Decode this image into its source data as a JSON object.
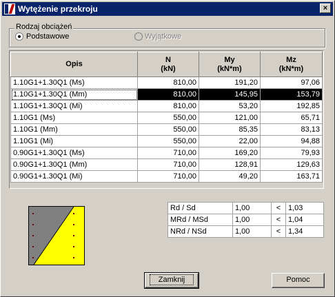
{
  "window": {
    "title": "Wytężenie przekroju",
    "close_glyph": "×"
  },
  "load_group": {
    "title": "Rodzaj obciążeń",
    "options": [
      {
        "label": "Podstawowe",
        "selected": true,
        "enabled": true
      },
      {
        "label": "Wyjątkowe",
        "selected": false,
        "enabled": false
      }
    ]
  },
  "table": {
    "columns": [
      {
        "line1": "Opis",
        "line2": ""
      },
      {
        "line1": "N",
        "line2": "(kN)"
      },
      {
        "line1": "My",
        "line2": "(kN*m)"
      },
      {
        "line1": "Mz",
        "line2": "(kN*m)"
      }
    ],
    "rows": [
      [
        "1.10G1+1.30Q1 (Ms)",
        "810,00",
        "191,20",
        "97,06"
      ],
      [
        "1.10G1+1.30Q1 (Mm)",
        "810,00",
        "145,95",
        "153,79"
      ],
      [
        "1.10G1+1.30Q1 (Mi)",
        "810,00",
        "53,20",
        "192,85"
      ],
      [
        "1.10G1 (Ms)",
        "550,00",
        "121,00",
        "65,71"
      ],
      [
        "1.10G1 (Mm)",
        "550,00",
        "85,35",
        "83,13"
      ],
      [
        "1.10G1 (Mi)",
        "550,00",
        "22,00",
        "94,88"
      ],
      [
        "0.90G1+1.30Q1 (Ms)",
        "710,00",
        "169,20",
        "79,93"
      ],
      [
        "0.90G1+1.30Q1 (Mm)",
        "710,00",
        "128,91",
        "129,63"
      ],
      [
        "0.90G1+1.30Q1 (Mi)",
        "710,00",
        "49,20",
        "163,71"
      ]
    ],
    "selected_row": 1
  },
  "ratios": [
    {
      "label": "Rd / Sd",
      "value": "1,00",
      "op": "<",
      "limit": "1,03"
    },
    {
      "label": "MRd / MSd",
      "value": "1,00",
      "op": "<",
      "limit": "1,04"
    },
    {
      "label": "NRd / NSd",
      "value": "1,00",
      "op": "<",
      "limit": "1,34"
    }
  ],
  "section_colors": {
    "compression": "#ffff00",
    "tension": "#808080",
    "rebar": "#800000"
  },
  "buttons": {
    "close_label": "Zamknij",
    "help_label": "Pomoc"
  }
}
